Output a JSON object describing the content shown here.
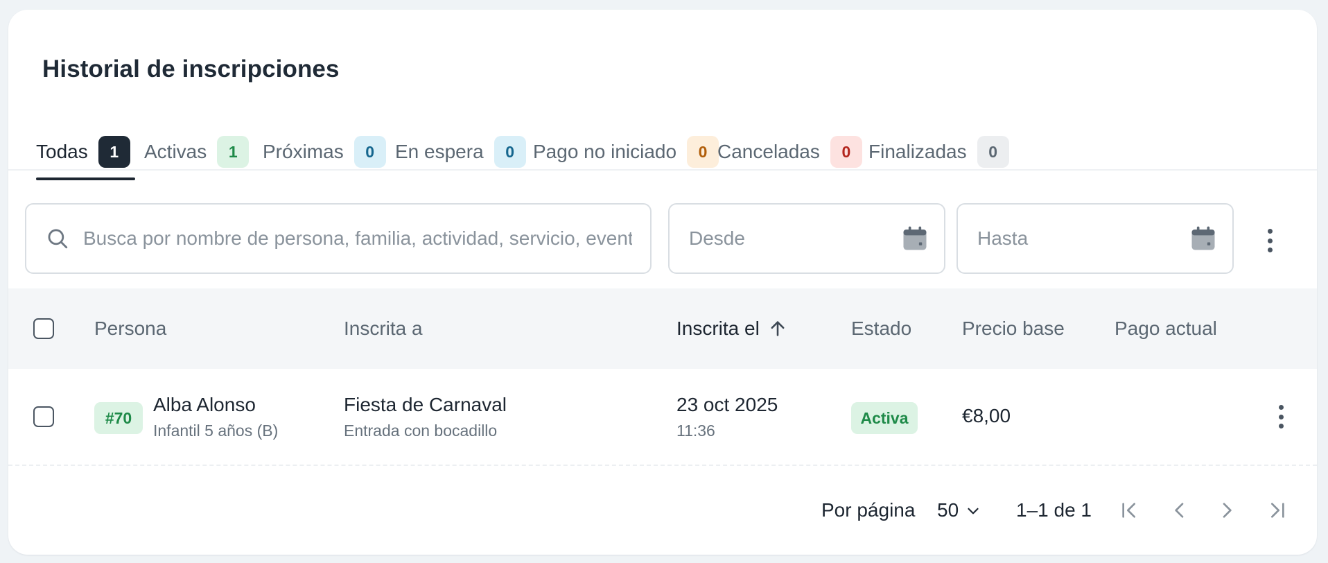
{
  "page": {
    "title": "Historial de inscripciones"
  },
  "tabs": [
    {
      "label": "Todas",
      "count": "1",
      "badge_bg": "#1f2a36",
      "badge_fg": "#ffffff",
      "active": true
    },
    {
      "label": "Activas",
      "count": "1",
      "badge_bg": "#dcf3e4",
      "badge_fg": "#1e8a48"
    },
    {
      "label": "Próximas",
      "count": "0",
      "badge_bg": "#d9eff8",
      "badge_fg": "#15668e"
    },
    {
      "label": "En espera",
      "count": "0",
      "badge_bg": "#d9eff8",
      "badge_fg": "#15668e"
    },
    {
      "label": "Pago no iniciado",
      "count": "0",
      "badge_bg": "#fdeedb",
      "badge_fg": "#b15e0a"
    },
    {
      "label": "Canceladas",
      "count": "0",
      "badge_bg": "#fde2e0",
      "badge_fg": "#b3261e"
    },
    {
      "label": "Finalizadas",
      "count": "0",
      "badge_bg": "#eceef0",
      "badge_fg": "#5b6772"
    }
  ],
  "filters": {
    "search_placeholder": "Busca por nombre de persona, familia, actividad, servicio, evento",
    "from_placeholder": "Desde",
    "to_placeholder": "Hasta"
  },
  "table": {
    "columns": {
      "persona": "Persona",
      "inscrita_a": "Inscrita a",
      "inscrita_el": "Inscrita el",
      "estado": "Estado",
      "precio_base": "Precio base",
      "pago_actual": "Pago actual"
    },
    "sort_column": "Inscrita el",
    "sort_direction": "ascending",
    "rows": [
      {
        "id_badge": "#70",
        "person_name": "Alba Alonso",
        "person_group": "Infantil 5 años (B)",
        "activity": "Fiesta de Carnaval",
        "activity_detail": "Entrada con bocadillo",
        "date": "23 oct 2025",
        "time": "11:36",
        "status": "Activa",
        "base_price": "€8,00",
        "current_payment": ""
      }
    ]
  },
  "pagination": {
    "per_page_label": "Por página",
    "per_page_value": "50",
    "range_label": "1–1 de 1"
  },
  "colors": {
    "accent_dark": "#1f2a36",
    "status_active_bg": "#dcf3e4",
    "status_active_fg": "#1e8a48"
  },
  "icons": [
    "search-icon",
    "calendar-icon",
    "more-vertical-icon",
    "arrow-up-icon",
    "chevron-down-icon",
    "first-page-icon",
    "previous-page-icon",
    "next-page-icon",
    "last-page-icon"
  ]
}
